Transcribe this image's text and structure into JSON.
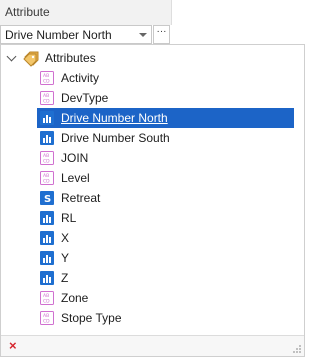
{
  "header": {
    "title": "Attribute"
  },
  "selector": {
    "value": "Drive Number North",
    "button_label": "···"
  },
  "tree": {
    "root": {
      "label": "Attributes",
      "icon": "folder-tag-icon",
      "expanded": true
    },
    "items": [
      {
        "label": "Activity",
        "icon": "text-abc-icon"
      },
      {
        "label": "DevType",
        "icon": "text-abc-icon"
      },
      {
        "label": "Drive Number North",
        "icon": "numeric-icon",
        "selected": true
      },
      {
        "label": "Drive Number South",
        "icon": "numeric-icon"
      },
      {
        "label": "JOIN",
        "icon": "text-abc-icon"
      },
      {
        "label": "Level",
        "icon": "text-abc-icon"
      },
      {
        "label": "Retreat",
        "icon": "dollar-icon"
      },
      {
        "label": "RL",
        "icon": "numeric-icon"
      },
      {
        "label": "X",
        "icon": "numeric-icon"
      },
      {
        "label": "Y",
        "icon": "numeric-icon"
      },
      {
        "label": "Z",
        "icon": "numeric-icon"
      },
      {
        "label": "Zone",
        "icon": "text-abc-icon"
      },
      {
        "label": "Stope Type",
        "icon": "text-abc-icon"
      }
    ]
  },
  "footer": {
    "close_label": "×"
  },
  "colors": {
    "selection": "#1c64c7",
    "text_icon": "#d070d0",
    "numeric_icon": "#1f6fd0",
    "close": "#d6262e"
  }
}
